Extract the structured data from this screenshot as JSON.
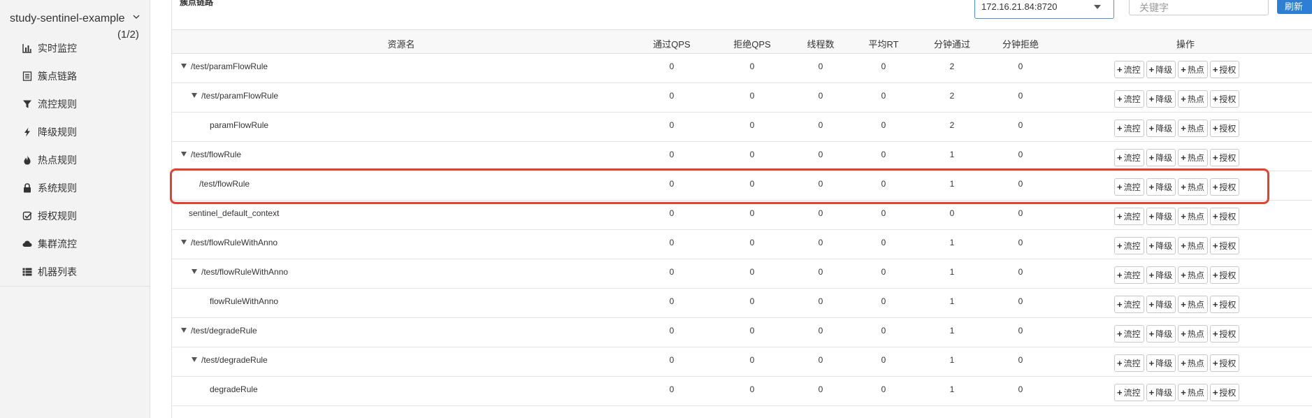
{
  "sidebar": {
    "app_name": "study-sentinel-example",
    "app_count": "(1/2)",
    "items": [
      {
        "label": "实时监控",
        "icon": "bar-chart-icon"
      },
      {
        "label": "簇点链路",
        "icon": "list-icon"
      },
      {
        "label": "流控规则",
        "icon": "filter-icon"
      },
      {
        "label": "降级规则",
        "icon": "bolt-icon"
      },
      {
        "label": "热点规则",
        "icon": "fire-icon"
      },
      {
        "label": "系统规则",
        "icon": "lock-icon"
      },
      {
        "label": "授权规则",
        "icon": "check-square-icon"
      },
      {
        "label": "集群流控",
        "icon": "cloud-icon"
      },
      {
        "label": "机器列表",
        "icon": "th-list-icon"
      }
    ]
  },
  "main": {
    "page_label": "簇点链路",
    "machine_select": "172.16.21.84:8720",
    "search_placeholder": "关键字",
    "refresh_label": "刷新"
  },
  "table": {
    "headers": {
      "name": "资源名",
      "pass_qps": "通过QPS",
      "block_qps": "拒绝QPS",
      "threads": "线程数",
      "avg_rt": "平均RT",
      "minute_pass": "分钟通过",
      "minute_block": "分钟拒绝",
      "ops": "操作"
    },
    "op_labels": [
      "流控",
      "降级",
      "热点",
      "授权"
    ],
    "rows": [
      {
        "name": "/test/paramFlowRule",
        "level": 0,
        "toggle": true,
        "pass_qps": "0",
        "block_qps": "0",
        "threads": "0",
        "avg_rt": "0",
        "minute_pass": "2",
        "minute_block": "0"
      },
      {
        "name": "/test/paramFlowRule",
        "level": 1,
        "toggle": true,
        "pass_qps": "0",
        "block_qps": "0",
        "threads": "0",
        "avg_rt": "0",
        "minute_pass": "2",
        "minute_block": "0"
      },
      {
        "name": "paramFlowRule",
        "level": 2,
        "toggle": false,
        "pass_qps": "0",
        "block_qps": "0",
        "threads": "0",
        "avg_rt": "0",
        "minute_pass": "2",
        "minute_block": "0"
      },
      {
        "name": "/test/flowRule",
        "level": 0,
        "toggle": true,
        "pass_qps": "0",
        "block_qps": "0",
        "threads": "0",
        "avg_rt": "0",
        "minute_pass": "1",
        "minute_block": "0"
      },
      {
        "name": "/test/flowRule",
        "level": 1,
        "toggle": false,
        "pass_qps": "0",
        "block_qps": "0",
        "threads": "0",
        "avg_rt": "0",
        "minute_pass": "1",
        "minute_block": "0",
        "highlighted": true
      },
      {
        "name": "sentinel_default_context",
        "level": 0,
        "toggle": false,
        "pass_qps": "0",
        "block_qps": "0",
        "threads": "0",
        "avg_rt": "0",
        "minute_pass": "0",
        "minute_block": "0"
      },
      {
        "name": "/test/flowRuleWithAnno",
        "level": 0,
        "toggle": true,
        "pass_qps": "0",
        "block_qps": "0",
        "threads": "0",
        "avg_rt": "0",
        "minute_pass": "1",
        "minute_block": "0"
      },
      {
        "name": "/test/flowRuleWithAnno",
        "level": 1,
        "toggle": true,
        "pass_qps": "0",
        "block_qps": "0",
        "threads": "0",
        "avg_rt": "0",
        "minute_pass": "1",
        "minute_block": "0"
      },
      {
        "name": "flowRuleWithAnno",
        "level": 2,
        "toggle": false,
        "pass_qps": "0",
        "block_qps": "0",
        "threads": "0",
        "avg_rt": "0",
        "minute_pass": "1",
        "minute_block": "0"
      },
      {
        "name": "/test/degradeRule",
        "level": 0,
        "toggle": true,
        "pass_qps": "0",
        "block_qps": "0",
        "threads": "0",
        "avg_rt": "0",
        "minute_pass": "1",
        "minute_block": "0"
      },
      {
        "name": "/test/degradeRule",
        "level": 1,
        "toggle": true,
        "pass_qps": "0",
        "block_qps": "0",
        "threads": "0",
        "avg_rt": "0",
        "minute_pass": "1",
        "minute_block": "0"
      },
      {
        "name": "degradeRule",
        "level": 2,
        "toggle": false,
        "pass_qps": "0",
        "block_qps": "0",
        "threads": "0",
        "avg_rt": "0",
        "minute_pass": "1",
        "minute_block": "0"
      }
    ]
  },
  "colors": {
    "accent": "#2d7fd6",
    "highlight": "#e8402c"
  }
}
